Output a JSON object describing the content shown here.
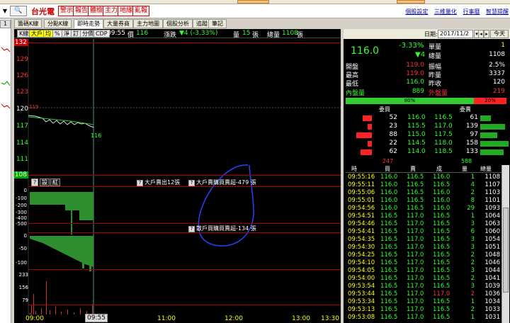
{
  "toolbar": {
    "stock_name": "台光電",
    "buttons": [
      "警示",
      "報告",
      "體檢",
      "主力",
      "地緣",
      "亂報"
    ],
    "right_links": [
      "個股設定",
      "三維量化",
      "行事曆",
      "智慧提醒"
    ]
  },
  "tabs": [
    "籌碼K線",
    "分點K線",
    "即時走勢",
    "大量券商",
    "主力地圖",
    "個股分析",
    "追蹤",
    "筆記"
  ],
  "active_tab": "即時走勢",
  "left_tab": "1",
  "infobar": {
    "buttons": [
      "K線",
      "大戶",
      "均",
      "%",
      "淨",
      "訂",
      "分價",
      "CDP"
    ],
    "time": "09:55",
    "price_label": "價",
    "price": "116",
    "change_label": "漲跌",
    "change": "▼4 (-3.33%)",
    "vol_label": "量",
    "vol": "15",
    "vol_unit": "張",
    "total_label": "總量",
    "total": "1108",
    "total_unit": "張"
  },
  "y_axis": [
    "132",
    "129",
    "126",
    "123",
    "120",
    "117",
    "114",
    "111",
    "108"
  ],
  "price_tag": "116",
  "price_small": "119",
  "sub1": {
    "buttons": [
      "?",
      "設",
      "紅"
    ],
    "note1": "大戶賣出12張",
    "note2": "大戶賣購買賣超-479 張",
    "y": [
      "0",
      "-100",
      "-200",
      "-300",
      "-400",
      "-500"
    ]
  },
  "sub2": {
    "note": "散戶買購買賣超-134 張",
    "y": [
      "0",
      "-50",
      "-100"
    ]
  },
  "sub3": {
    "y": [
      "233",
      "156",
      "79"
    ]
  },
  "x_axis": [
    "09:00",
    "11:00",
    "12:00",
    "13:00",
    "13:30"
  ],
  "cursor_time": "09:55",
  "right": {
    "date_label": "日期:",
    "date": "2017/11/2",
    "today": "今天",
    "price": "116.0",
    "pct": "-3.33%",
    "chg": "▼4",
    "quote_rows": [
      [
        "單量",
        "1"
      ],
      [
        "總量",
        "1108"
      ]
    ],
    "stats": [
      [
        "開盤",
        "119.0",
        "振幅",
        "2.5%"
      ],
      [
        "最高",
        "119.0",
        "昨量",
        "3337"
      ],
      [
        "最低",
        "116.0",
        "昨收",
        "120"
      ]
    ],
    "inner_label": "內盤量",
    "inner": "889",
    "outer_label": "外盤量",
    "outer": "219",
    "bar_left": "80%",
    "bar_right": "20%",
    "bar_left_frac": 0.8,
    "book_head_buy": "委買",
    "book_head_sell": "委賣",
    "book": [
      {
        "bq": "52",
        "bp": "116.0",
        "sp": "116.5",
        "sq": "61"
      },
      {
        "bq": "23",
        "bp": "115.5",
        "sp": "117.0",
        "sq": "139"
      },
      {
        "bq": "88",
        "bp": "115.0",
        "sp": "117.5",
        "sq": "97"
      },
      {
        "bq": "22",
        "bp": "114.5",
        "sp": "118.0",
        "sq": "158"
      },
      {
        "bq": "62",
        "bp": "114.0",
        "sp": "118.5",
        "sq": "133"
      }
    ],
    "book_total_buy": "247",
    "book_total_sell": "588",
    "ticks_head": [
      "時",
      "買",
      "賣",
      "成",
      "量",
      "總量"
    ],
    "ticks": [
      [
        "09:55:16",
        "116.0",
        "116.5",
        "116.0",
        "1",
        "1108"
      ],
      [
        "09:55:11",
        "116.0",
        "116.5",
        "116.5",
        "4",
        "1107"
      ],
      [
        "09:55:06",
        "116.0",
        "116.5",
        "116.0",
        "2",
        "1103"
      ],
      [
        "09:55:01",
        "116.0",
        "116.5",
        "116.0",
        "8",
        "1101"
      ],
      [
        "09:54:56",
        "116.0",
        "116.5",
        "116.0",
        "29",
        "1093"
      ],
      [
        "09:54:51",
        "116.5",
        "117.0",
        "116.5",
        "1",
        "1064"
      ],
      [
        "09:54:46",
        "116.5",
        "117.0",
        "116.5",
        "3",
        "1063"
      ],
      [
        "09:54:41",
        "116.5",
        "117.0",
        "116.5",
        "6",
        "1060"
      ],
      [
        "09:54:35",
        "116.5",
        "117.0",
        "116.5",
        "3",
        "1054"
      ],
      [
        "09:54:30",
        "116.5",
        "117.0",
        "116.5",
        "3",
        "1051"
      ],
      [
        "09:54:25",
        "116.5",
        "117.0",
        "116.5",
        "2",
        "1048"
      ],
      [
        "09:54:10",
        "116.5",
        "117.0",
        "116.5",
        "2",
        "1046"
      ],
      [
        "09:54:05",
        "116.5",
        "117.0",
        "116.5",
        "3",
        "1044"
      ],
      [
        "09:54:00",
        "116.5",
        "117.0",
        "116.5",
        "2",
        "1041"
      ],
      [
        "09:53:54",
        "116.5",
        "117.0",
        "116.5",
        "3",
        "1039"
      ],
      [
        "09:53:44",
        "116.5",
        "117.0",
        "117.0",
        "2",
        "1036"
      ],
      [
        "09:53:34",
        "116.5",
        "117.0",
        "116.5",
        "1",
        "1034"
      ],
      [
        "09:53:13",
        "116.5",
        "117.0",
        "116.5",
        "2",
        "1033"
      ],
      [
        "09:53:08",
        "116.5",
        "117.0",
        "116.5",
        "1",
        "1031"
      ]
    ]
  }
}
